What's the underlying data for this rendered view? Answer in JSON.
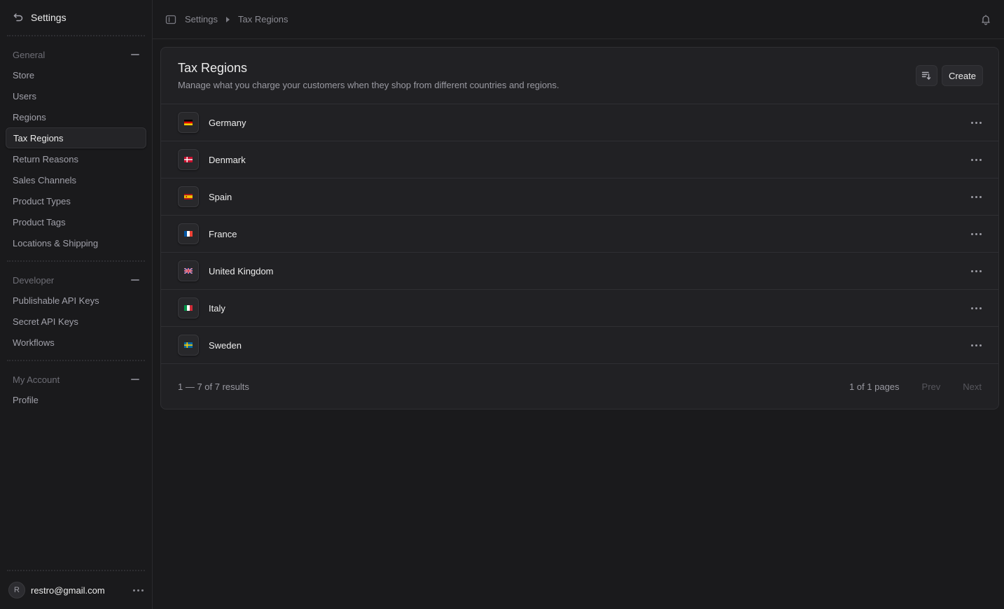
{
  "sidebar": {
    "title": "Settings",
    "sections": [
      {
        "label": "General",
        "items": [
          {
            "label": "Store"
          },
          {
            "label": "Users"
          },
          {
            "label": "Regions"
          },
          {
            "label": "Tax Regions",
            "active": true
          },
          {
            "label": "Return Reasons"
          },
          {
            "label": "Sales Channels"
          },
          {
            "label": "Product Types"
          },
          {
            "label": "Product Tags"
          },
          {
            "label": "Locations & Shipping"
          }
        ]
      },
      {
        "label": "Developer",
        "items": [
          {
            "label": "Publishable API Keys"
          },
          {
            "label": "Secret API Keys"
          },
          {
            "label": "Workflows"
          }
        ]
      },
      {
        "label": "My Account",
        "items": [
          {
            "label": "Profile"
          }
        ]
      }
    ],
    "user": {
      "initial": "R",
      "email": "restro@gmail.com"
    }
  },
  "topbar": {
    "breadcrumbs": [
      "Settings",
      "Tax Regions"
    ]
  },
  "card": {
    "title": "Tax Regions",
    "description": "Manage what you charge your customers when they shop from different countries and regions.",
    "create_label": "Create",
    "rows": [
      {
        "name": "Germany",
        "flag": "de"
      },
      {
        "name": "Denmark",
        "flag": "dk"
      },
      {
        "name": "Spain",
        "flag": "es"
      },
      {
        "name": "France",
        "flag": "fr"
      },
      {
        "name": "United Kingdom",
        "flag": "gb"
      },
      {
        "name": "Italy",
        "flag": "it"
      },
      {
        "name": "Sweden",
        "flag": "se"
      }
    ],
    "footer": {
      "count": "1 — 7 of 7 results",
      "pages": "1 of 1 pages",
      "prev": "Prev",
      "next": "Next"
    }
  },
  "flag_colors": {
    "de": [
      "#000000",
      "#DD0000",
      "#FFCE00"
    ],
    "dk": [
      "#C8102E",
      "#FFFFFF"
    ],
    "es": [
      "#AA151B",
      "#F1BF00"
    ],
    "fr": [
      "#0055A4",
      "#FFFFFF",
      "#EF4135"
    ],
    "gb": [
      "#012169",
      "#FFFFFF",
      "#C8102E"
    ],
    "it": [
      "#009246",
      "#FFFFFF",
      "#CE2B37"
    ],
    "se": [
      "#006AA7",
      "#FECC00"
    ]
  }
}
